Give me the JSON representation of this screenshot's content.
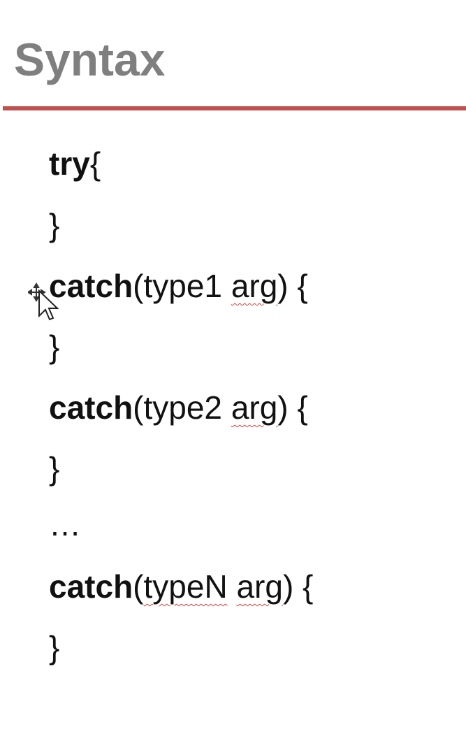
{
  "slide": {
    "title": "Syntax",
    "accent_color": "#c0504d",
    "title_color": "#7f7f7f"
  },
  "code": {
    "line1_kw": "try",
    "line1_rest": "{",
    "line2": "}",
    "line3_kw": "catch",
    "line3_open": "(type1 ",
    "line3_arg": "arg",
    "line3_close": ") {",
    "line4": "}",
    "line5_kw": "catch",
    "line5_open": "(type2 ",
    "line5_arg": "arg",
    "line5_close": ") {",
    "line6": "}",
    "line7": "…",
    "line8_kw": "catch",
    "line8_open": "(",
    "line8_type": "typeN",
    "line8_space": " ",
    "line8_arg": "arg",
    "line8_close": ") {",
    "line9": "}"
  },
  "cursor": {
    "icon": "move-cursor-icon"
  }
}
